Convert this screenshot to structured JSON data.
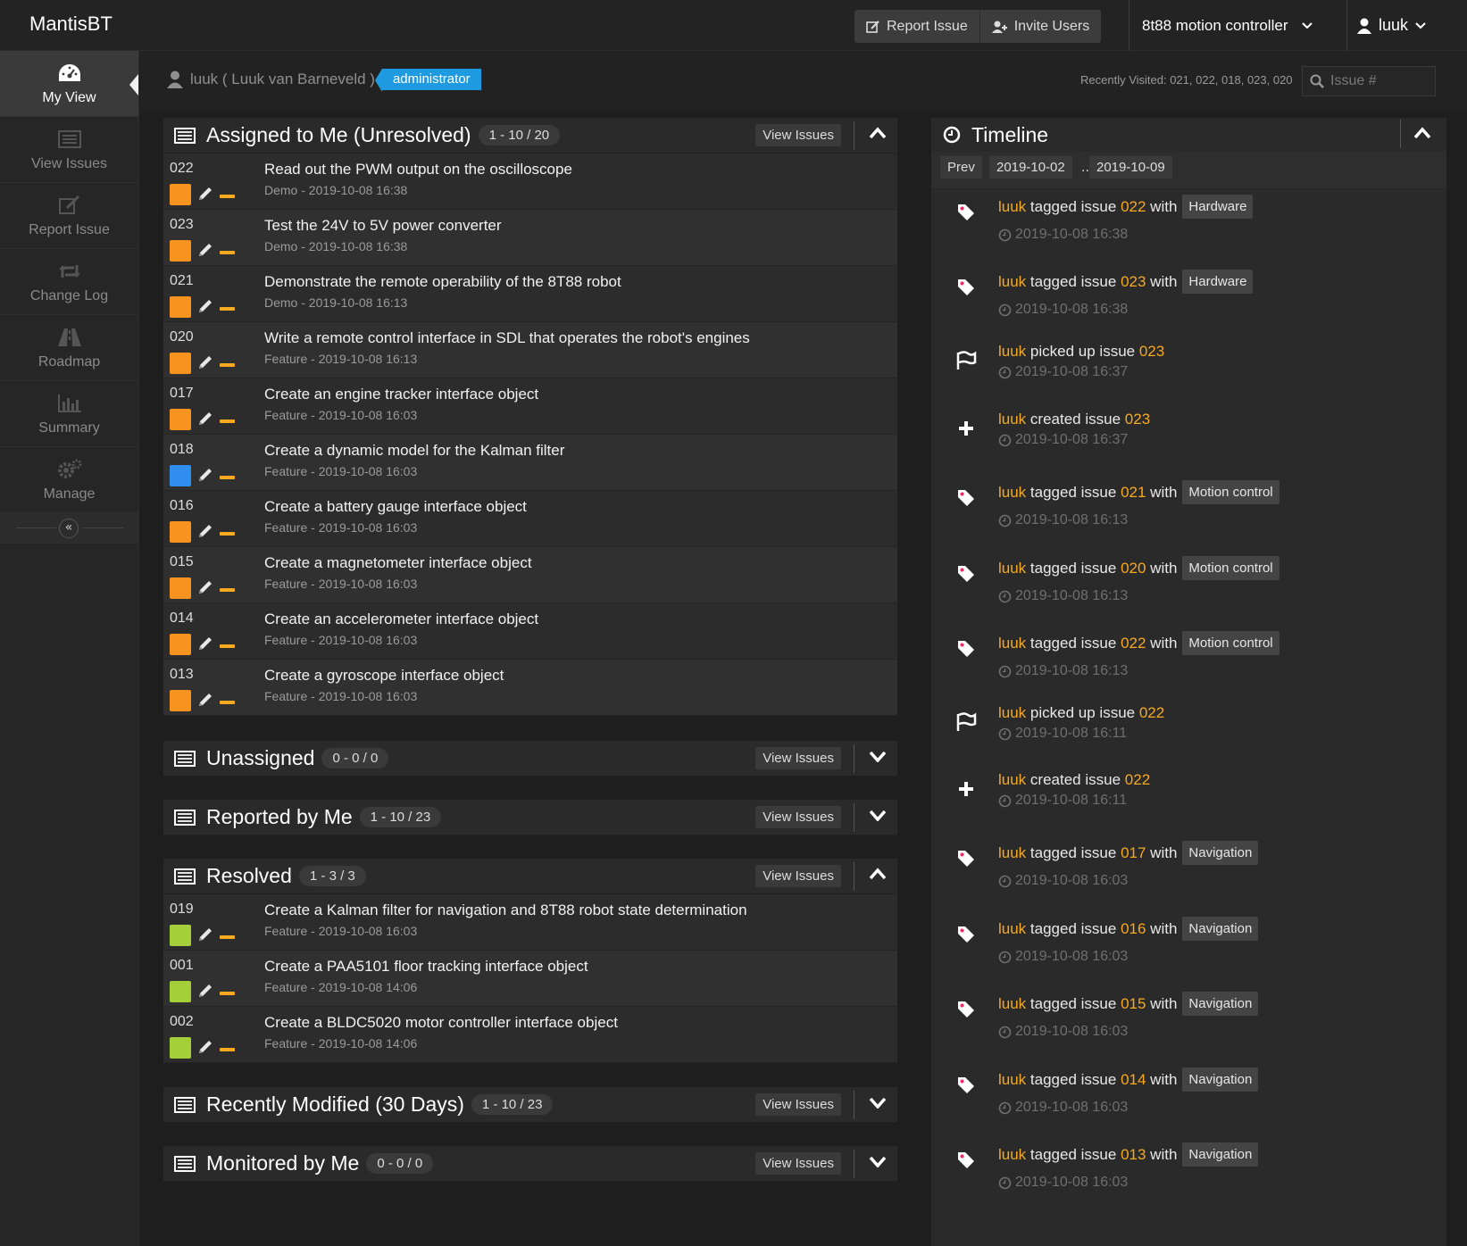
{
  "app": {
    "brand": "MantisBT"
  },
  "topbar": {
    "report_issue": "Report Issue",
    "invite_users": "Invite Users",
    "project": "8t88 motion controller",
    "user": "luuk"
  },
  "sidebar": {
    "items": [
      {
        "label": "My View",
        "icon": "dashboard-icon",
        "active": true
      },
      {
        "label": "View Issues",
        "icon": "list-icon"
      },
      {
        "label": "Report Issue",
        "icon": "edit-icon"
      },
      {
        "label": "Change Log",
        "icon": "retweet-icon"
      },
      {
        "label": "Roadmap",
        "icon": "road-icon"
      },
      {
        "label": "Summary",
        "icon": "bar-chart-icon"
      },
      {
        "label": "Manage",
        "icon": "gears-icon"
      }
    ],
    "collapse": "«"
  },
  "userbar": {
    "user": "luuk ( Luuk van Barneveld )",
    "role": "administrator",
    "recently_visited": "Recently Visited: 021, 022, 018, 023, 020",
    "search_placeholder": "Issue #"
  },
  "panels": {
    "assigned": {
      "title": "Assigned to Me (Unresolved)",
      "count": "1 - 10 / 20",
      "view": "View Issues",
      "rows": [
        {
          "id": "022",
          "summary": "Read out the PWM output on the oscilloscope",
          "meta": "Demo - 2019-10-08 16:38",
          "color": "#f7931e"
        },
        {
          "id": "023",
          "summary": "Test the 24V to 5V power converter",
          "meta": "Demo - 2019-10-08 16:38",
          "color": "#f7931e"
        },
        {
          "id": "021",
          "summary": "Demonstrate the remote operability of the 8T88 robot",
          "meta": "Demo - 2019-10-08 16:13",
          "color": "#f7931e"
        },
        {
          "id": "020",
          "summary": "Write a remote control interface in SDL that operates the robot's engines",
          "meta": "Feature - 2019-10-08 16:13",
          "color": "#f7931e"
        },
        {
          "id": "017",
          "summary": "Create an engine tracker interface object",
          "meta": "Feature - 2019-10-08 16:03",
          "color": "#f7931e"
        },
        {
          "id": "018",
          "summary": "Create a dynamic model for the Kalman filter",
          "meta": "Feature - 2019-10-08 16:03",
          "color": "#2f8ef0"
        },
        {
          "id": "016",
          "summary": "Create a battery gauge interface object",
          "meta": "Feature - 2019-10-08 16:03",
          "color": "#f7931e"
        },
        {
          "id": "015",
          "summary": "Create a magnetometer interface object",
          "meta": "Feature - 2019-10-08 16:03",
          "color": "#f7931e"
        },
        {
          "id": "014",
          "summary": "Create an accelerometer interface object",
          "meta": "Feature - 2019-10-08 16:03",
          "color": "#f7931e"
        },
        {
          "id": "013",
          "summary": "Create a gyroscope interface object",
          "meta": "Feature - 2019-10-08 16:03",
          "color": "#f7931e"
        }
      ]
    },
    "unassigned": {
      "title": "Unassigned",
      "count": "0 - 0 / 0",
      "view": "View Issues"
    },
    "reported": {
      "title": "Reported by Me",
      "count": "1 - 10 / 23",
      "view": "View Issues"
    },
    "resolved": {
      "title": "Resolved",
      "count": "1 - 3 / 3",
      "view": "View Issues",
      "rows": [
        {
          "id": "019",
          "summary": "Create a Kalman filter for navigation and 8T88 robot state determination",
          "meta": "Feature - 2019-10-08 16:03",
          "color": "#a4cf38"
        },
        {
          "id": "001",
          "summary": "Create a PAA5101 floor tracking interface object",
          "meta": "Feature - 2019-10-08 14:06",
          "color": "#a4cf38"
        },
        {
          "id": "002",
          "summary": "Create a BLDC5020 motor controller interface object",
          "meta": "Feature - 2019-10-08 14:06",
          "color": "#a4cf38"
        }
      ]
    },
    "recent": {
      "title": "Recently Modified (30 Days)",
      "count": "1 - 10 / 23",
      "view": "View Issues"
    },
    "monitored": {
      "title": "Monitored by Me",
      "count": "0 - 0 / 0",
      "view": "View Issues"
    }
  },
  "timeline": {
    "title": "Timeline",
    "prev": "Prev",
    "from": "2019-10-02",
    "sep": "..",
    "to": "2019-10-09",
    "events": [
      {
        "kind": "tag",
        "user": "luuk",
        "verb": "tagged issue",
        "issue": "022",
        "with": "with",
        "tag": "Hardware",
        "time": "2019-10-08 16:38"
      },
      {
        "kind": "tag",
        "user": "luuk",
        "verb": "tagged issue",
        "issue": "023",
        "with": "with",
        "tag": "Hardware",
        "time": "2019-10-08 16:38"
      },
      {
        "kind": "pick",
        "user": "luuk",
        "verb": "picked up issue",
        "issue": "023",
        "with": "",
        "tag": "",
        "time": "2019-10-08 16:37"
      },
      {
        "kind": "create",
        "user": "luuk",
        "verb": "created issue",
        "issue": "023",
        "with": "",
        "tag": "",
        "time": "2019-10-08 16:37"
      },
      {
        "kind": "tag",
        "user": "luuk",
        "verb": "tagged issue",
        "issue": "021",
        "with": "with",
        "tag": "Motion control",
        "time": "2019-10-08 16:13"
      },
      {
        "kind": "tag",
        "user": "luuk",
        "verb": "tagged issue",
        "issue": "020",
        "with": "with",
        "tag": "Motion control",
        "time": "2019-10-08 16:13"
      },
      {
        "kind": "tag",
        "user": "luuk",
        "verb": "tagged issue",
        "issue": "022",
        "with": "with",
        "tag": "Motion control",
        "time": "2019-10-08 16:13"
      },
      {
        "kind": "pick",
        "user": "luuk",
        "verb": "picked up issue",
        "issue": "022",
        "with": "",
        "tag": "",
        "time": "2019-10-08 16:11"
      },
      {
        "kind": "create",
        "user": "luuk",
        "verb": "created issue",
        "issue": "022",
        "with": "",
        "tag": "",
        "time": "2019-10-08 16:11"
      },
      {
        "kind": "tag",
        "user": "luuk",
        "verb": "tagged issue",
        "issue": "017",
        "with": "with",
        "tag": "Navigation",
        "time": "2019-10-08 16:03"
      },
      {
        "kind": "tag",
        "user": "luuk",
        "verb": "tagged issue",
        "issue": "016",
        "with": "with",
        "tag": "Navigation",
        "time": "2019-10-08 16:03"
      },
      {
        "kind": "tag",
        "user": "luuk",
        "verb": "tagged issue",
        "issue": "015",
        "with": "with",
        "tag": "Navigation",
        "time": "2019-10-08 16:03"
      },
      {
        "kind": "tag",
        "user": "luuk",
        "verb": "tagged issue",
        "issue": "014",
        "with": "with",
        "tag": "Navigation",
        "time": "2019-10-08 16:03"
      },
      {
        "kind": "tag",
        "user": "luuk",
        "verb": "tagged issue",
        "issue": "013",
        "with": "with",
        "tag": "Navigation",
        "time": "2019-10-08 16:03"
      }
    ]
  },
  "colors": {
    "accent": "#f7a920",
    "tag_event": "#ec2c6a",
    "pick_event": "#f7a920",
    "create_event": "#1e9be0",
    "admin_badge": "#1e9be0"
  }
}
